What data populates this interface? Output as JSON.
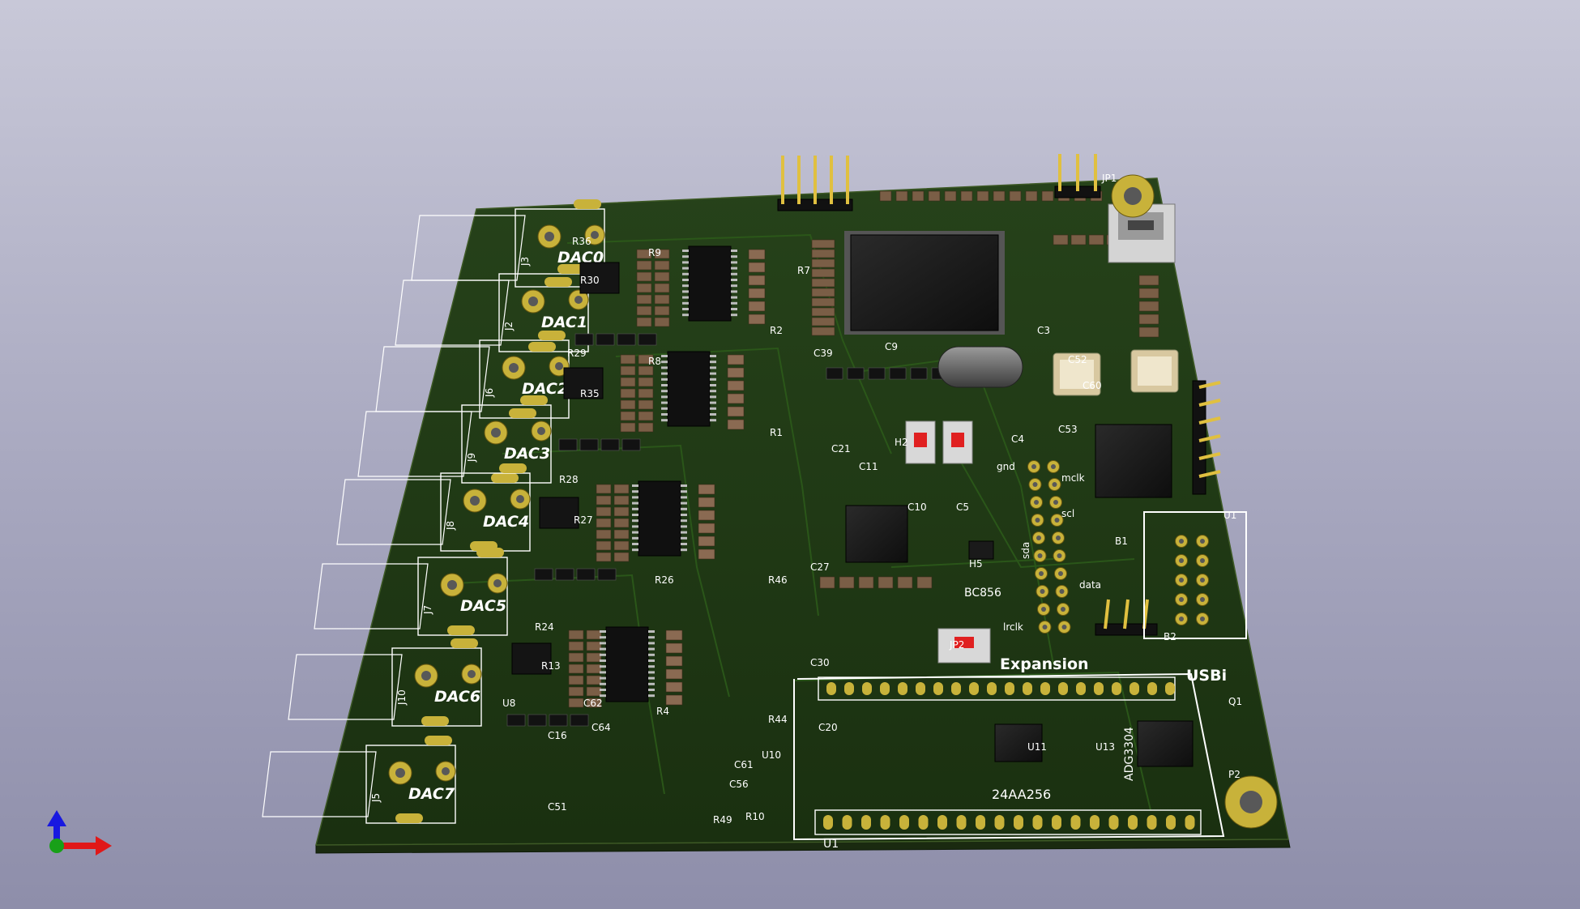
{
  "viewer": {
    "background_top": "#c8c8d8",
    "background_bottom": "#8e8eaa",
    "axes": {
      "x_color": "#e01818",
      "z_color": "#1818e0",
      "y_color": "#18a018"
    }
  },
  "board": {
    "solder_mask_color": "#1f3a12",
    "pad_color": "#c8b23a",
    "silk_color": "#ffffff",
    "connector_labels": [
      "DAC0",
      "DAC1",
      "DAC2",
      "DAC3",
      "DAC4",
      "DAC5",
      "DAC6",
      "DAC7"
    ],
    "connector_refs": [
      "J3",
      "J2",
      "J6",
      "J9",
      "J8",
      "J7",
      "J10",
      "J5"
    ],
    "section_labels": {
      "expansion": "Expansion",
      "usbi": "USBi",
      "eeprom": "24AA256",
      "mux": "ADG3304",
      "transistor": "BC856",
      "mcu_module": "U1"
    },
    "header_labels": {
      "gnd": "gnd",
      "mclk": "mclk",
      "scl": "scl",
      "sda": "sda",
      "data": "data",
      "lrclk": "lrclk"
    },
    "component_refs": [
      "R36",
      "R30",
      "R29",
      "R35",
      "R28",
      "R27",
      "R24",
      "R13",
      "R9",
      "R8",
      "R26",
      "R4",
      "R2",
      "R1",
      "R46",
      "R44",
      "R49",
      "R10",
      "R7",
      "C39",
      "C27",
      "C20",
      "C21",
      "C30",
      "C11",
      "C9",
      "C10",
      "C5",
      "C4",
      "C53",
      "C52",
      "C60",
      "C51",
      "C56",
      "C61",
      "C62",
      "C64",
      "C16",
      "C3",
      "U8",
      "U10",
      "U11",
      "U13",
      "U1",
      "P2",
      "JP1",
      "JP2",
      "H2",
      "H5",
      "B1",
      "B2",
      "Q1"
    ]
  }
}
